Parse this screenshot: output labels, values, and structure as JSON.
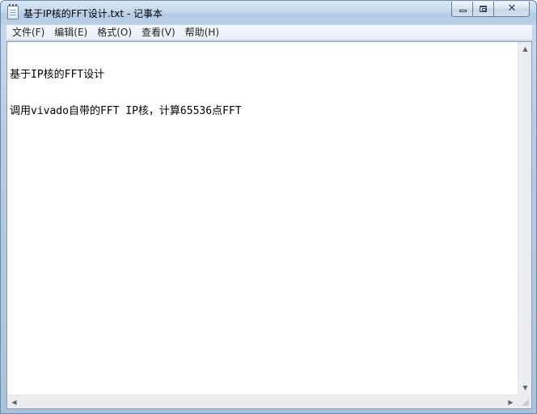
{
  "window": {
    "title": "基于IP核的FFT设计.txt - 记事本",
    "icon": "notepad-icon",
    "buttons": {
      "minimize": "minimize-icon",
      "maximize": "maximize-icon",
      "close": "✕"
    }
  },
  "menubar": {
    "items": [
      {
        "label": "文件(F)"
      },
      {
        "label": "编辑(E)"
      },
      {
        "label": "格式(O)"
      },
      {
        "label": "查看(V)"
      },
      {
        "label": "帮助(H)"
      }
    ]
  },
  "editor": {
    "lines": [
      "基于IP核的FFT设计",
      "调用vivado自带的FFT IP核，计算65536点FFT"
    ]
  },
  "scrollbars": {
    "up": "▲",
    "down": "▼",
    "left": "◀",
    "right": "▶"
  },
  "colors": {
    "frame": "#b7cde4",
    "menubar": "#f0f4f9",
    "editor_bg": "#ffffff"
  }
}
